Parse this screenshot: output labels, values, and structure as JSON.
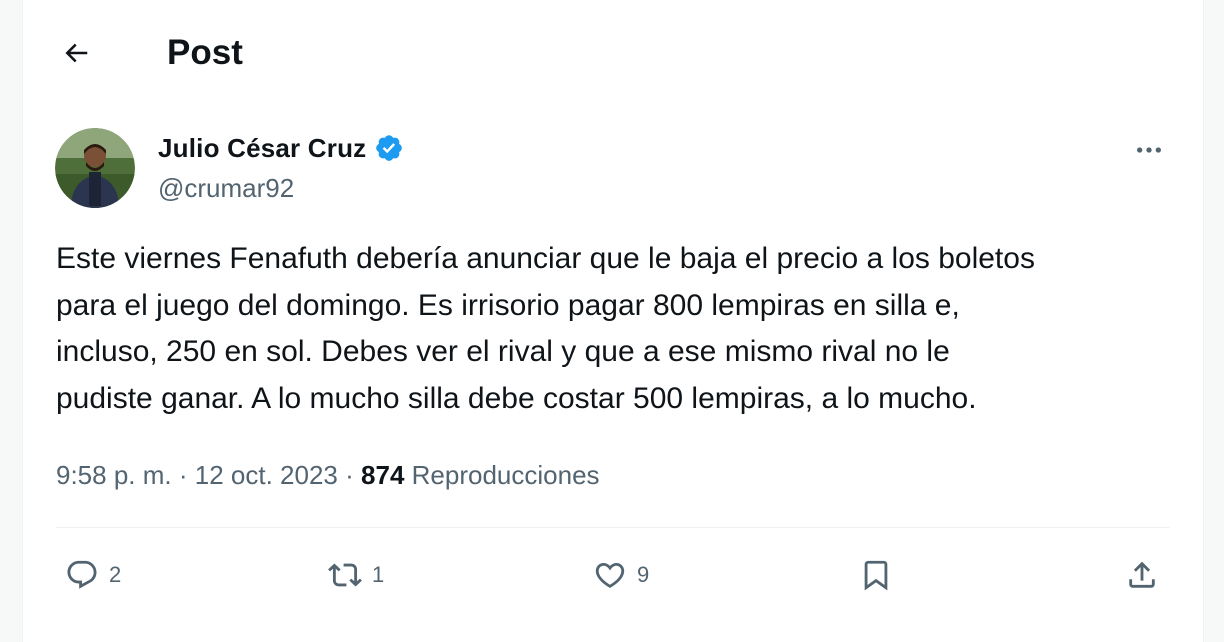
{
  "header": {
    "back_icon": "arrow-left-icon",
    "title": "Post"
  },
  "author": {
    "display_name": "Julio César Cruz",
    "handle": "@crumar92",
    "verified": true,
    "verified_color": "#1d9bf0"
  },
  "tweet": {
    "text": "Este viernes Fenafuth debería anunciar que le baja el precio a los boletos\npara el juego del domingo. Es irrisorio pagar 800 lempiras en silla e,\nincluso, 250 en sol. Debes ver el rival y que a ese mismo rival no le\npudiste ganar. A lo mucho silla debe costar 500 lempiras, a lo mucho.",
    "time": "9:58 p. m.",
    "separator": "·",
    "date": "12 oct. 2023",
    "views_count": "874",
    "views_label": "Reproducciones"
  },
  "actions": {
    "reply": {
      "icon": "reply-icon",
      "count": "2"
    },
    "retweet": {
      "icon": "retweet-icon",
      "count": "1"
    },
    "like": {
      "icon": "heart-icon",
      "count": "9"
    },
    "bookmark": {
      "icon": "bookmark-icon"
    },
    "share": {
      "icon": "share-icon"
    }
  },
  "colors": {
    "text_primary": "#0f1419",
    "text_secondary": "#536471",
    "divider": "#eff3f4"
  }
}
